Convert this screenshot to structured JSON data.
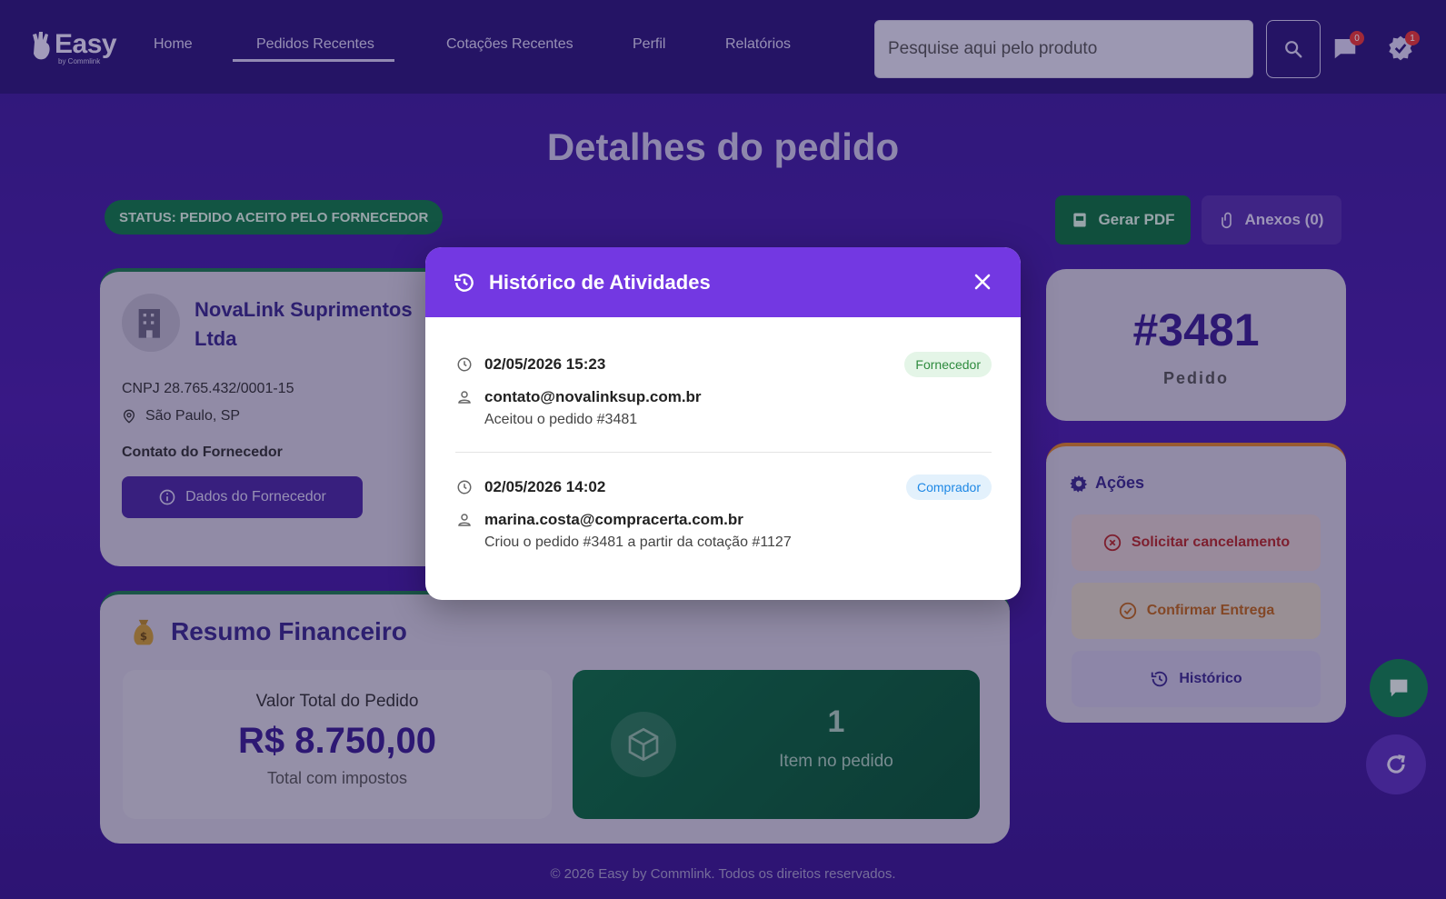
{
  "nav": {
    "logo": "Easy",
    "logo_sub": "by Commlink",
    "links": [
      "Home",
      "Pedidos Recentes",
      "Cotações Recentes",
      "Perfil",
      "Relatórios"
    ],
    "search_placeholder": "Pesquise aqui pelo produto",
    "chat_badge": "0",
    "notif_badge": "1"
  },
  "page": {
    "title": "Detalhes do pedido",
    "status": "STATUS: PEDIDO ACEITO PELO FORNECEDOR",
    "btn_pdf": "Gerar PDF",
    "btn_anexos": "Anexos (0)"
  },
  "supplier": {
    "name": "NovaLink Suprimentos Ltda",
    "cnpj": "CNPJ 28.765.432/0001-15",
    "location": "São Paulo, SP",
    "contact_label": "Contato do Fornecedor",
    "btn_dados": "Dados do Fornecedor"
  },
  "finance": {
    "title": "Resumo Financeiro",
    "valor_label": "Valor Total do Pedido",
    "valor": "R$ 8.750,00",
    "valor_sub": "Total com impostos",
    "items_count": "1",
    "items_label": "Item no pedido"
  },
  "pedido": {
    "number": "#3481",
    "label": "Pedido"
  },
  "acoes": {
    "title": "Ações",
    "cancel": "Solicitar cancelamento",
    "confirm": "Confirmar Entrega",
    "historico": "Histórico"
  },
  "modal": {
    "title": "Histórico de Atividades",
    "entries": [
      {
        "date": "02/05/2026 15:23",
        "role": "Fornecedor",
        "email": "contato@novalinksup.com.br",
        "action": "Aceitou o pedido #3481"
      },
      {
        "date": "02/05/2026 14:02",
        "role": "Comprador",
        "email": "marina.costa@compracerta.com.br",
        "action": "Criou o pedido #3481 a partir da cotação #1127"
      }
    ]
  },
  "footer": "© 2026 Easy by Commlink. Todos os direitos reservados.",
  "colors": {
    "primary": "#7338e2",
    "success": "#127a48",
    "danger": "#b02a2a",
    "warning": "#b8651c"
  }
}
